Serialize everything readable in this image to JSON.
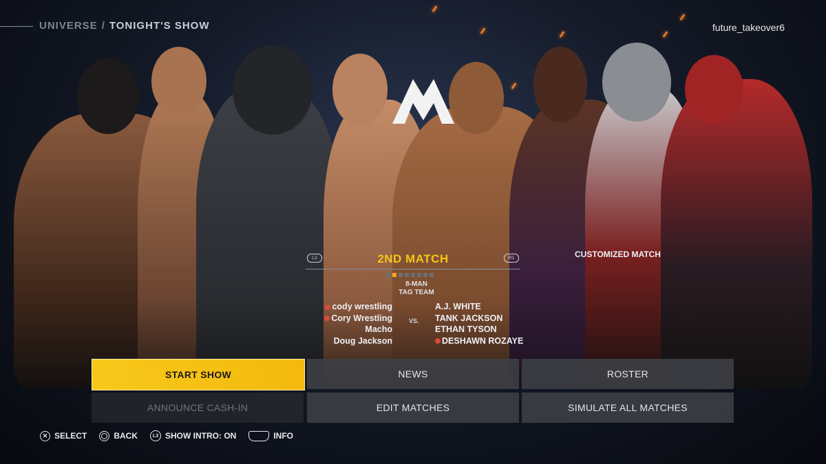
{
  "header": {
    "crumb_root": "UNIVERSE",
    "crumb_sep": "/",
    "crumb_current": "TONIGHT'S SHOW",
    "username": "future_takeover6"
  },
  "match": {
    "l_bumper": "L1",
    "r_bumper": "R1",
    "title": "2ND MATCH",
    "type_line1": "8-MAN",
    "type_line2": "TAG TEAM",
    "vs": "VS.",
    "custom_label": "CUSTOMIZED MATCH",
    "team_left": [
      "cody wrestling",
      "Cory Wrestling",
      "Macho",
      "Doug Jackson"
    ],
    "team_right": [
      "A.J. WHITE",
      "TANK JACKSON",
      "ETHAN TYSON",
      "DESHAWN ROZAYE"
    ]
  },
  "menu": {
    "start_show": "START SHOW",
    "news": "NEWS",
    "roster": "ROSTER",
    "announce_cash_in": "ANNOUNCE CASH-IN",
    "edit_matches": "EDIT MATCHES",
    "simulate_all": "SIMULATE ALL MATCHES"
  },
  "footer": {
    "select": "SELECT",
    "back": "BACK",
    "show_intro": "SHOW INTRO: ON",
    "info": "INFO",
    "cross_glyph": "✕",
    "l3_glyph": "L3"
  },
  "colors": {
    "accent": "#f5c518",
    "primary_button": "#f7c81b",
    "button_bg": "#3e4046",
    "remote_icon": "#d94a3d"
  }
}
